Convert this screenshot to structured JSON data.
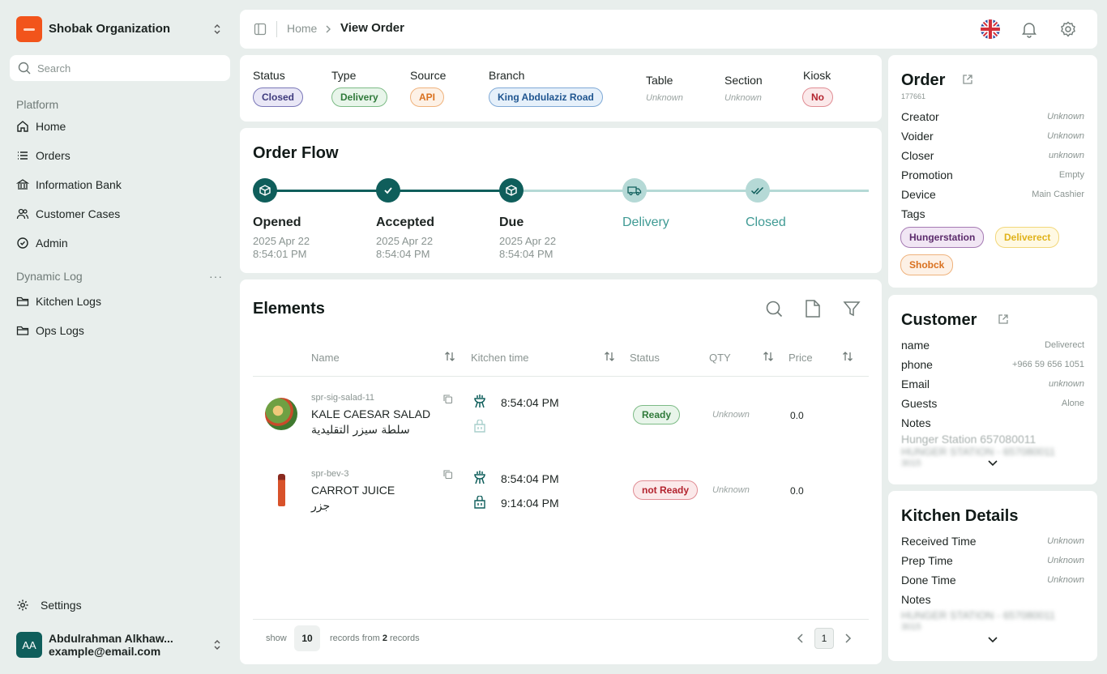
{
  "sidebar": {
    "org_name": "Shobak Organization",
    "search_placeholder": "Search",
    "platform_title": "Platform",
    "platform_items": [
      {
        "label": "Home",
        "icon": "home-icon"
      },
      {
        "label": "Orders",
        "icon": "list-icon"
      },
      {
        "label": "Information Bank",
        "icon": "bank-icon"
      },
      {
        "label": "Customer Cases",
        "icon": "users-icon"
      },
      {
        "label": "Admin",
        "icon": "check-circle-icon"
      }
    ],
    "dynamic_title": "Dynamic Log",
    "dynamic_items": [
      {
        "label": "Kitchen Logs",
        "icon": "folder-icon"
      },
      {
        "label": "Ops Logs",
        "icon": "folder-icon"
      }
    ],
    "settings_label": "Settings",
    "user": {
      "initials": "AA",
      "name": "Abdulrahman Alkhaw...",
      "email": "example@email.com"
    }
  },
  "topbar": {
    "crumb_home": "Home",
    "crumb_current": "View Order"
  },
  "meta": {
    "status": {
      "label": "Status",
      "value": "Closed"
    },
    "type": {
      "label": "Type",
      "value": "Delivery"
    },
    "source": {
      "label": "Source",
      "value": "API"
    },
    "branch": {
      "label": "Branch",
      "value": "King Abdulaziz Road"
    },
    "table": {
      "label": "Table",
      "value": "Unknown"
    },
    "section": {
      "label": "Section",
      "value": "Unknown"
    },
    "kiosk": {
      "label": "Kiosk",
      "value": "No"
    }
  },
  "flow": {
    "title": "Order Flow",
    "steps": [
      {
        "title": "Opened",
        "date": "2025 Apr 22",
        "time": "8:54:01 PM"
      },
      {
        "title": "Accepted",
        "date": "2025 Apr 22",
        "time": "8:54:04 PM"
      },
      {
        "title": "Due",
        "date": "2025 Apr 22",
        "time": "8:54:04 PM"
      },
      {
        "title": "Delivery",
        "date": "",
        "time": ""
      },
      {
        "title": "Closed",
        "date": "",
        "time": ""
      }
    ]
  },
  "elements": {
    "title": "Elements",
    "columns": {
      "name": "Name",
      "kitchen": "Kitchen time",
      "status": "Status",
      "qty": "QTY",
      "price": "Price"
    },
    "rows": [
      {
        "sku": "spr-sig-salad-11",
        "name": "KALE CAESAR SALAD",
        "name_ar": "سلطة سيزر التقليدية",
        "time1": "8:54:04 PM",
        "time2": "",
        "status": "Ready",
        "qty": "Unknown",
        "price": "0.0"
      },
      {
        "sku": "spr-bev-3",
        "name": "CARROT JUICE",
        "name_ar": "جزر",
        "time1": "8:54:04 PM",
        "time2": "9:14:04 PM",
        "status": "not Ready",
        "qty": "Unknown",
        "price": "0.0"
      }
    ],
    "footer": {
      "show": "show",
      "page_size": "10",
      "records_prefix": "records from",
      "records_count": "2",
      "records_suffix": "records",
      "page": "1"
    }
  },
  "order": {
    "title": "Order",
    "id": "177661",
    "rows": [
      {
        "label": "Creator",
        "value": "Unknown"
      },
      {
        "label": "Voider",
        "value": "Unknown"
      },
      {
        "label": "Closer",
        "value": "unknown"
      },
      {
        "label": "Promotion",
        "value": "Empty"
      },
      {
        "label": "Device",
        "value": "Main Cashier"
      }
    ],
    "tags_label": "Tags",
    "tags": [
      "Hungerstation",
      "Deliverect",
      "Shobck"
    ]
  },
  "customer": {
    "title": "Customer",
    "rows": [
      {
        "label": "name",
        "value": "Deliverect"
      },
      {
        "label": "phone",
        "value": "+966 59 656 1051"
      },
      {
        "label": "Email",
        "value": "unknown"
      },
      {
        "label": "Guests",
        "value": "Alone"
      }
    ],
    "notes_label": "Notes",
    "notes_line1": "Hunger Station 657080011",
    "notes_line2": "HUNGER STATION - 657080011",
    "notes_line3": "3015"
  },
  "kitchen": {
    "title": "Kitchen Details",
    "rows": [
      {
        "label": "Received Time",
        "value": "Unknown"
      },
      {
        "label": "Prep Time",
        "value": "Unknown"
      },
      {
        "label": "Done Time",
        "value": "Unknown"
      }
    ],
    "notes_label": "Notes",
    "notes_line1": "HUNGER STATION - 657080011",
    "notes_line2": "3015"
  },
  "colors": {
    "accent": "#0f5e5b",
    "accent_light": "#b5d9d6",
    "bg": "#e8eeec"
  }
}
